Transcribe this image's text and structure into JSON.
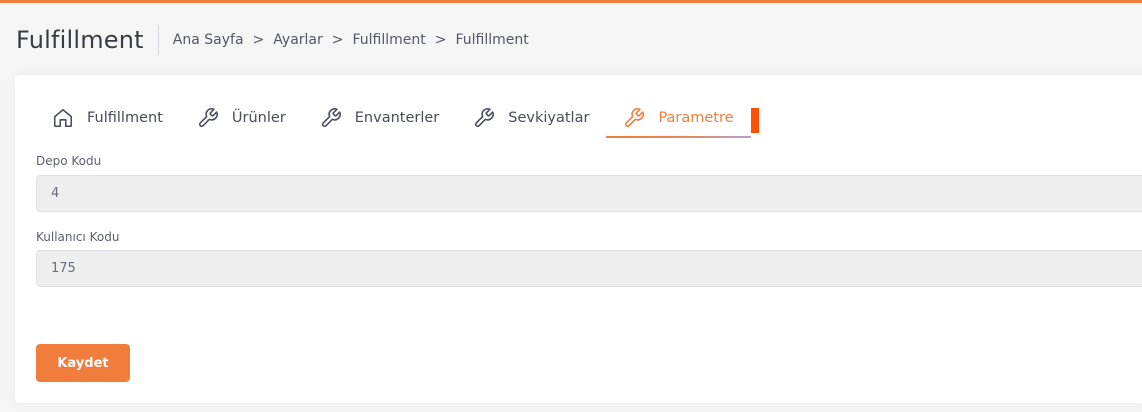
{
  "colors": {
    "accent": "#f07d3c",
    "marker": "#ff4f00"
  },
  "header": {
    "title": "Fulfillment",
    "breadcrumb": [
      "Ana Sayfa",
      "Ayarlar",
      "Fulfillment",
      "Fulfillment"
    ]
  },
  "tabs": [
    {
      "label": "Fulfillment",
      "icon": "home-icon"
    },
    {
      "label": "Ürünler",
      "icon": "wrench-icon"
    },
    {
      "label": "Envanterler",
      "icon": "wrench-icon"
    },
    {
      "label": "Sevkiyatlar",
      "icon": "wrench-icon"
    },
    {
      "label": "Parametre",
      "icon": "wrench-icon",
      "active": true
    }
  ],
  "form": {
    "depo_kodu": {
      "label": "Depo Kodu",
      "value": "4"
    },
    "kullanici_kodu": {
      "label": "Kullanıcı Kodu",
      "value": "175"
    },
    "save_label": "Kaydet"
  }
}
